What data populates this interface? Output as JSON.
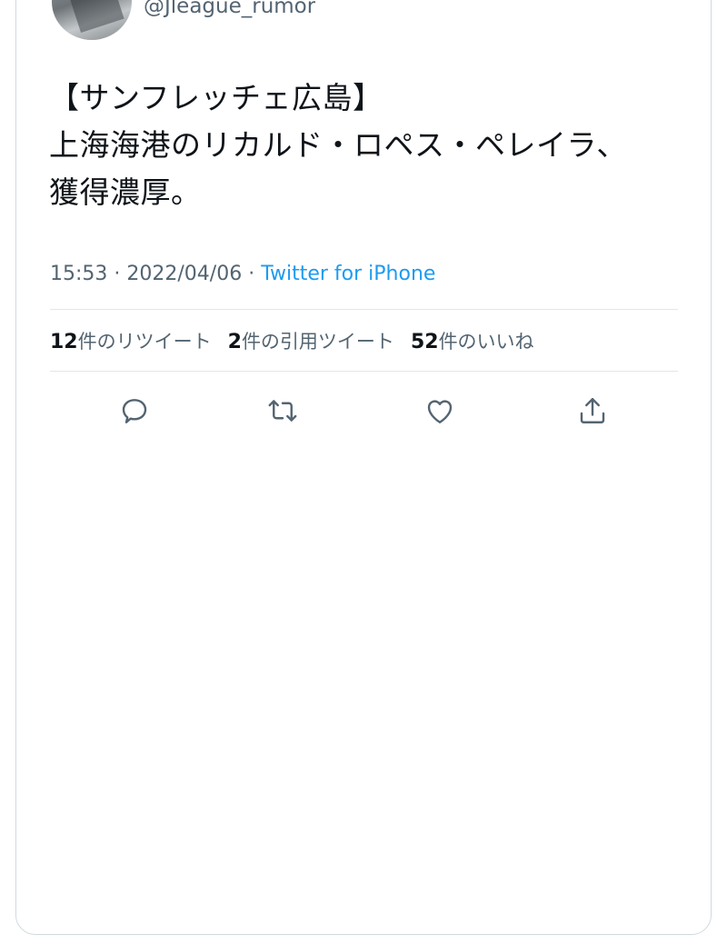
{
  "tweet": {
    "handle": "@Jleague_rumor",
    "text": "【サンフレッチェ広島】\n上海海港のリカルド・ロペス・ペレイラ、\n獲得濃厚。",
    "time": "15:53",
    "date": "2022/04/06",
    "separator": " · ",
    "source": "Twitter for iPhone"
  },
  "stats": {
    "retweets_count": "12",
    "retweets_label": "件のリツイート",
    "quotes_count": "2",
    "quotes_label": "件の引用ツイート",
    "likes_count": "52",
    "likes_label": "件のいいね"
  },
  "actions": {
    "icons": [
      "reply-icon",
      "retweet-icon",
      "like-icon",
      "share-icon"
    ]
  },
  "colors": {
    "text": "#0f1419",
    "secondary": "#536471",
    "link": "#1d9bf0",
    "border": "#cfd9de"
  }
}
